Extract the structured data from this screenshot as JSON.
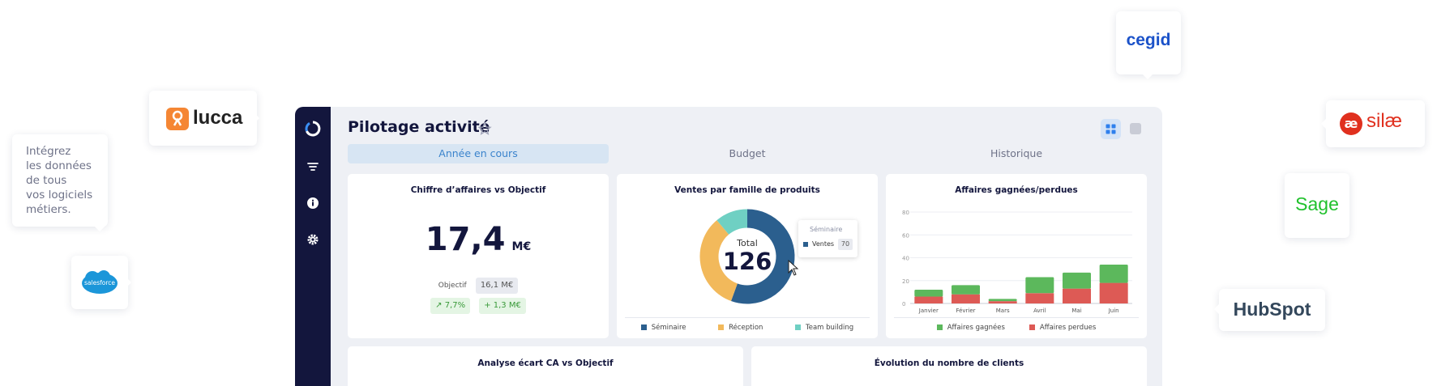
{
  "promo": {
    "text_lines": [
      "Intégrez",
      "les données",
      "de tous",
      "vos logiciels",
      "métiers."
    ]
  },
  "logos": {
    "lucca": "lucca",
    "cegid": "cegid",
    "silae": "silæ",
    "sage": "Sage",
    "hubspot": "HubSpot",
    "salesforce": "salesforce"
  },
  "app": {
    "title": "Pilotage activité",
    "tabs": [
      {
        "label": "Année en cours",
        "active": true
      },
      {
        "label": "Budget",
        "active": false
      },
      {
        "label": "Historique",
        "active": false
      }
    ]
  },
  "kpi_card": {
    "title": "Chiffre d’affaires vs Objectif",
    "value": "17,4",
    "unit": "M€",
    "objective_label": "Objectif",
    "objective_value": "16,1 M€",
    "delta_pct": "↗ 7,7%",
    "delta_abs": "+ 1,3 M€"
  },
  "donut_card": {
    "title": "Ventes par famille de produits",
    "center_label": "Total",
    "center_value": "126",
    "tooltip": {
      "title": "Séminaire",
      "label": "Ventes",
      "value": "70"
    },
    "legend": [
      "Séminaire",
      "Réception",
      "Team building"
    ]
  },
  "bar_card": {
    "title": "Affaires gagnées/perdues",
    "legend": [
      "Affaires gagnées",
      "Affaires perdues"
    ]
  },
  "bottom_cards": {
    "left_title": "Analyse écart CA vs Objectif",
    "right_title": "Évolution du nombre de clients"
  },
  "colors": {
    "rail": "#13163d",
    "seminaire": "#2b5f8e",
    "reception": "#f2b95b",
    "team_building": "#6fd0c3",
    "gagnees": "#5cb85c",
    "perdues": "#dd5a55",
    "active_tab": "#3a83cc"
  },
  "chart_data": [
    {
      "type": "pie",
      "title": "Ventes par famille de produits",
      "categories": [
        "Séminaire",
        "Réception",
        "Team building"
      ],
      "values": [
        70,
        42,
        14
      ],
      "total": 126
    },
    {
      "type": "bar",
      "title": "Affaires gagnées/perdues",
      "categories": [
        "Janvier",
        "Février",
        "Mars",
        "Avril",
        "Mai",
        "Juin"
      ],
      "stacked": true,
      "series": [
        {
          "name": "Affaires perdues",
          "values": [
            6,
            8,
            2,
            9,
            13,
            18
          ]
        },
        {
          "name": "Affaires gagnées",
          "values": [
            6,
            8,
            2,
            14,
            14,
            16
          ]
        }
      ],
      "yticks": [
        "0",
        "20",
        "40",
        "60",
        "80"
      ],
      "ylim": [
        0,
        80
      ]
    }
  ]
}
